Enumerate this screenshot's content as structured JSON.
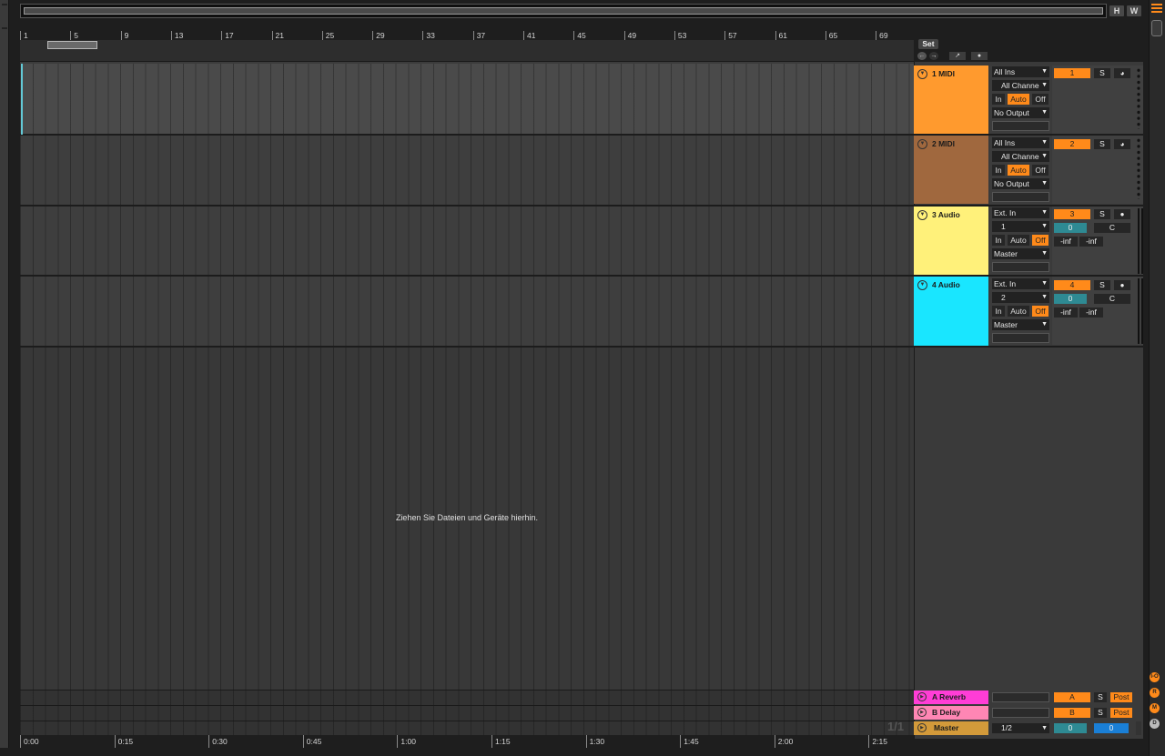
{
  "window": {
    "hotswap_h": "H",
    "hotswap_w": "W"
  },
  "ruler": {
    "bars": [
      "1",
      "5",
      "9",
      "13",
      "17",
      "21",
      "25",
      "29",
      "33",
      "37",
      "41",
      "45",
      "49",
      "53",
      "57",
      "61",
      "65",
      "69"
    ],
    "times": [
      "0:00",
      "0:15",
      "0:30",
      "0:45",
      "1:00",
      "1:15",
      "1:30",
      "1:45",
      "2:00",
      "2:15"
    ]
  },
  "set": {
    "label": "Set",
    "drop_hint": "Ziehen Sie Dateien und Geräte hierhin.",
    "page_indicator": "1/1"
  },
  "tracks": [
    {
      "name": "1 MIDI",
      "color": "#ff9a2e",
      "input_type": "All Ins",
      "input_channel": "All Channe",
      "monitor": [
        "In",
        "Auto",
        "Off"
      ],
      "monitor_active": "Auto",
      "output": "No Output",
      "number": "1",
      "solo": "S",
      "arm_icon": "clock-icon",
      "lane_shade": "light"
    },
    {
      "name": "2 MIDI",
      "color": "#a0683e",
      "input_type": "All Ins",
      "input_channel": "All Channe",
      "monitor": [
        "In",
        "Auto",
        "Off"
      ],
      "monitor_active": "Auto",
      "output": "No Output",
      "number": "2",
      "solo": "S",
      "arm_icon": "clock-icon",
      "lane_shade": "dark"
    },
    {
      "name": "3 Audio",
      "color": "#fff17a",
      "input_type": "Ext. In",
      "input_channel": "1",
      "monitor": [
        "In",
        "Auto",
        "Off"
      ],
      "monitor_active": "Off",
      "output": "Master",
      "number": "3",
      "solo": "S",
      "arm_icon": "record-icon",
      "volume": "0",
      "pan": "C",
      "meter_l": "-inf",
      "meter_r": "-inf",
      "lane_shade": "dark"
    },
    {
      "name": "4 Audio",
      "color": "#19e6ff",
      "input_type": "Ext. In",
      "input_channel": "2",
      "monitor": [
        "In",
        "Auto",
        "Off"
      ],
      "monitor_active": "Off",
      "output": "Master",
      "number": "4",
      "solo": "S",
      "arm_icon": "record-icon",
      "volume": "0",
      "pan": "C",
      "meter_l": "-inf",
      "meter_r": "-inf",
      "lane_shade": "dark"
    }
  ],
  "returns": [
    {
      "name": "A Reverb",
      "color": "#ff3dd6",
      "number": "A",
      "solo": "S",
      "post": "Post"
    },
    {
      "name": "B Delay",
      "color": "#ff86b4",
      "number": "B",
      "solo": "S",
      "post": "Post"
    }
  ],
  "master": {
    "name": "Master",
    "color": "#d39a3a",
    "output": "1/2",
    "volume": "0",
    "pan_value": "0"
  },
  "side_buttons": [
    "I-O",
    "R",
    "M",
    "D"
  ],
  "colors": {
    "accent": "#ff8a1a",
    "volume": "#2e8a93",
    "master_pan": "#1a7fd6"
  }
}
